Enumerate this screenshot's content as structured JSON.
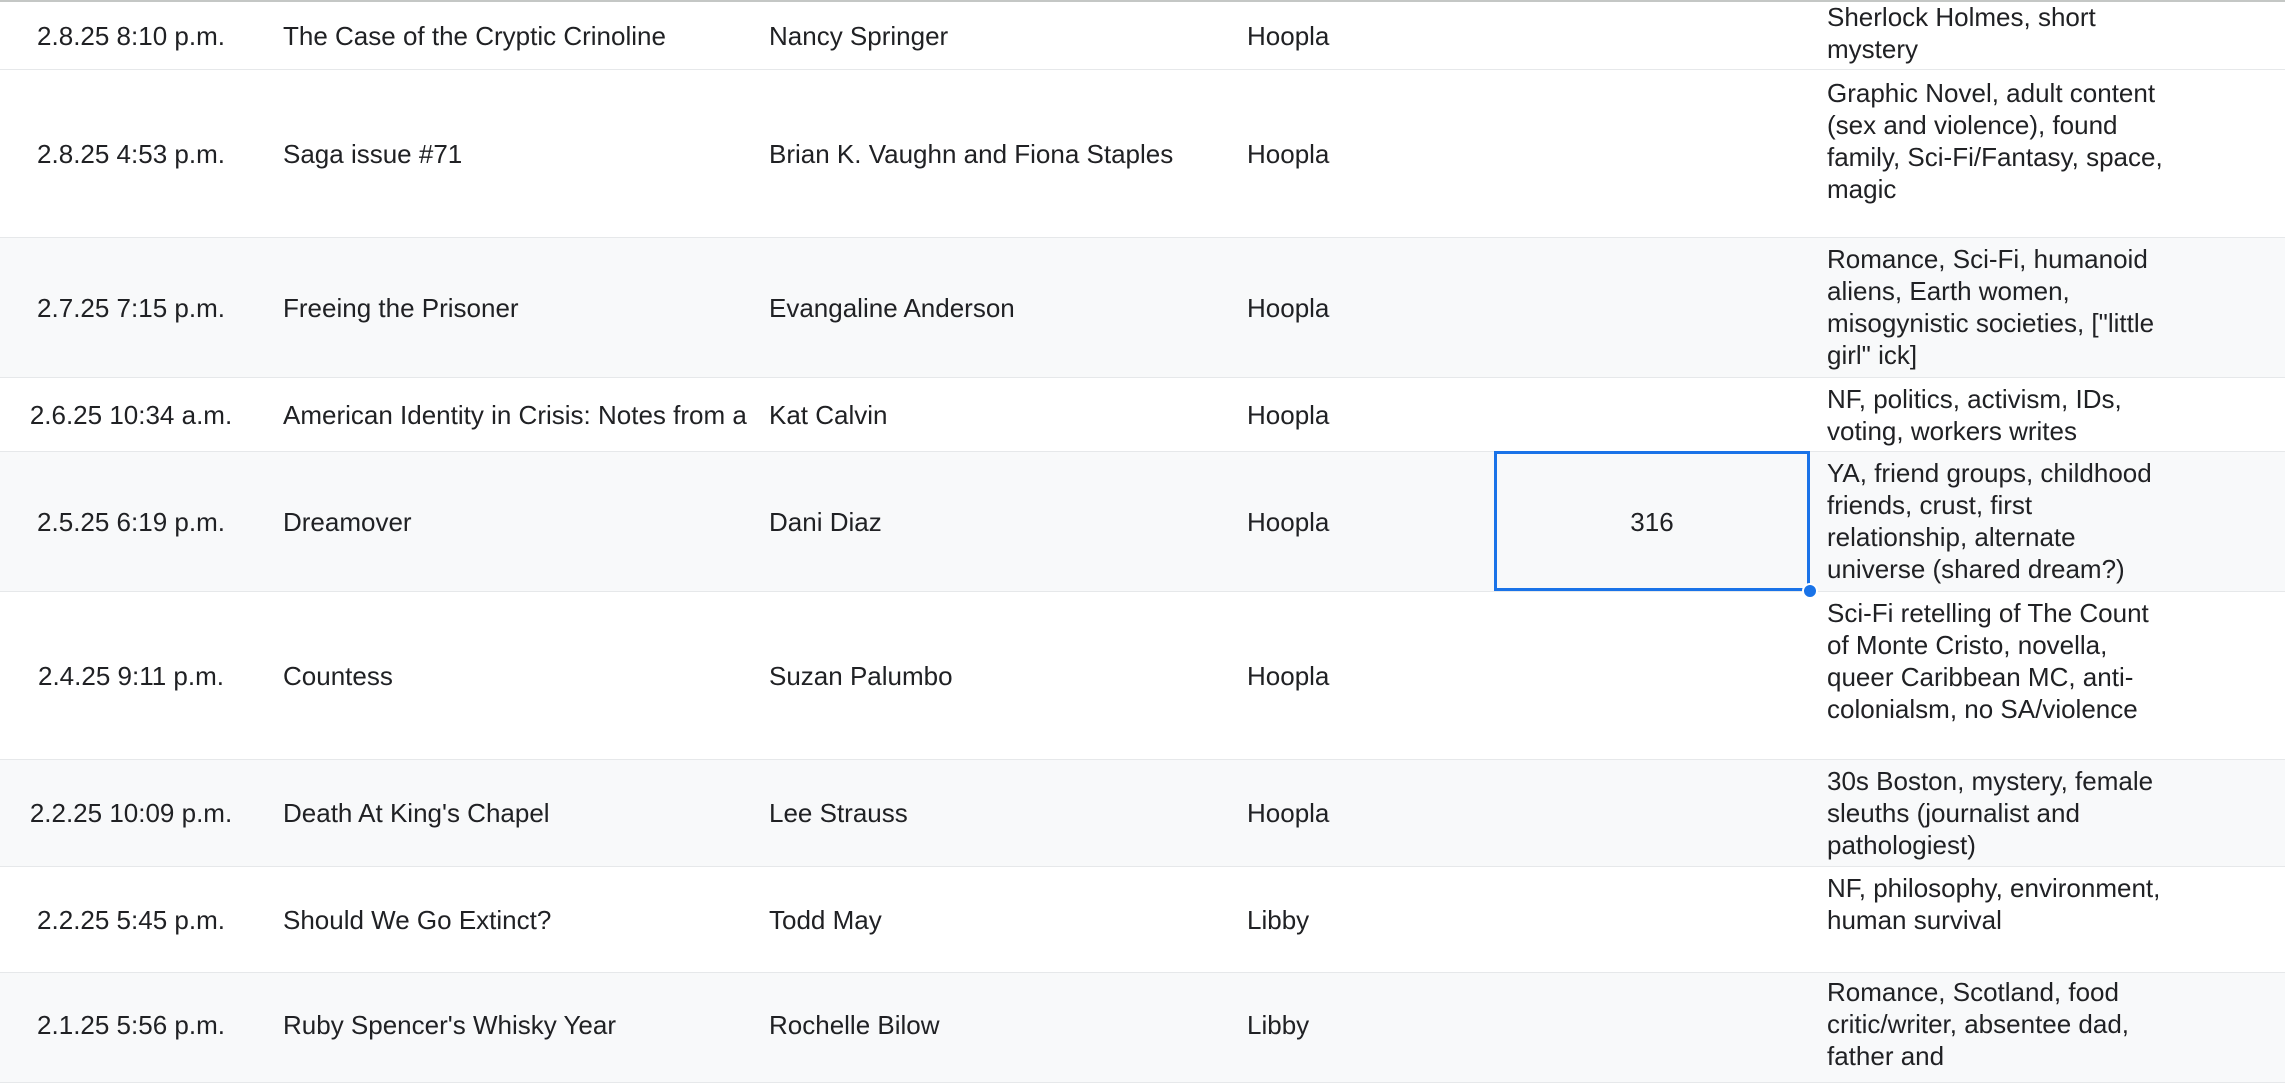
{
  "rows": [
    {
      "date": "2.8.25 8:10 p.m.",
      "title": "The Case of the Cryptic Crinoline",
      "author": "Nancy Springer",
      "source": "Hoopla",
      "pages": "",
      "notes": "Sherlock Holmes, short mystery"
    },
    {
      "date": "2.8.25 4:53 p.m.",
      "title": "Saga issue #71",
      "author": "Brian K. Vaughn and Fiona Staples",
      "source": "Hoopla",
      "pages": "",
      "notes": "Graphic Novel, adult content (sex and violence), found family, Sci-Fi/Fantasy, space, magic"
    },
    {
      "date": "2.7.25 7:15 p.m.",
      "title": "Freeing the Prisoner",
      "author": "Evangaline Anderson",
      "source": "Hoopla",
      "pages": "",
      "notes": "Romance, Sci-Fi, humanoid aliens, Earth women, misogynistic societies, [\"little girl\" ick]"
    },
    {
      "date": "2.6.25 10:34 a.m.",
      "title": "American Identity in Crisis: Notes from a",
      "author": "Kat Calvin",
      "source": "Hoopla",
      "pages": "",
      "notes": "NF, politics, activism, IDs, voting, workers writes"
    },
    {
      "date": "2.5.25 6:19 p.m.",
      "title": "Dreamover",
      "author": "Dani Diaz",
      "source": "Hoopla",
      "pages": "316",
      "notes": "YA, friend groups, childhood friends, crust, first relationship, alternate universe (shared dream?)"
    },
    {
      "date": "2.4.25 9:11 p.m.",
      "title": "Countess",
      "author": "Suzan Palumbo",
      "source": "Hoopla",
      "pages": "",
      "notes": "Sci-Fi retelling of The Count of Monte Cristo, novella, queer Caribbean MC, anti-colonialsm, no SA/violence"
    },
    {
      "date": "2.2.25 10:09 p.m.",
      "title": "Death At King's Chapel",
      "author": "Lee Strauss",
      "source": "Hoopla",
      "pages": "",
      "notes": "30s Boston, mystery, female sleuths (journalist and pathologiest)"
    },
    {
      "date": "2.2.25 5:45 p.m.",
      "title": "Should We Go Extinct?",
      "author": "Todd May",
      "source": "Libby",
      "pages": "",
      "notes": "NF, philosophy, environment, human survival"
    },
    {
      "date": "2.1.25 5:56 p.m.",
      "title": "Ruby Spencer's Whisky Year",
      "author": "Rochelle Bilow",
      "source": "Libby",
      "pages": "",
      "notes": "Romance, Scotland, food critic/writer, absentee dad, father and"
    }
  ]
}
